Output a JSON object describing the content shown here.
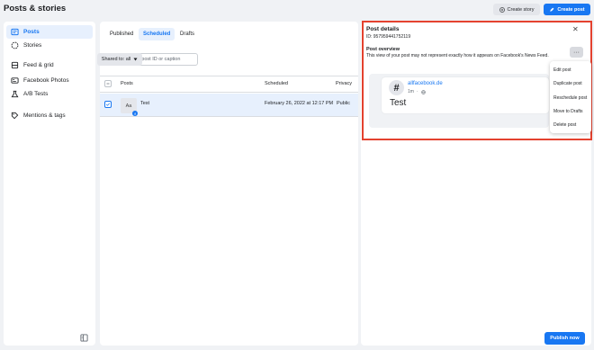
{
  "header": {
    "title": "Posts & stories",
    "create_story_label": "Create story",
    "create_post_label": "Create post"
  },
  "sidebar": {
    "items": [
      {
        "label": "Posts",
        "icon": "posts-icon",
        "active": true
      },
      {
        "label": "Stories",
        "icon": "stories-icon",
        "active": false
      },
      {
        "label": "Feed & grid",
        "icon": "feed-grid-icon",
        "active": false
      },
      {
        "label": "Facebook Photos",
        "icon": "photos-icon",
        "active": false
      },
      {
        "label": "A/B Tests",
        "icon": "ab-test-icon",
        "active": false
      },
      {
        "label": "Mentions & tags",
        "icon": "tag-icon",
        "active": false
      }
    ]
  },
  "center": {
    "tabs": [
      {
        "label": "Published",
        "active": false
      },
      {
        "label": "Scheduled",
        "active": true
      },
      {
        "label": "Drafts",
        "active": false
      }
    ],
    "search": {
      "placeholder": "Search by post ID or caption",
      "value": ""
    },
    "filter": {
      "label": "Shared to: all"
    },
    "table": {
      "columns": [
        "Posts",
        "Scheduled",
        "Privacy"
      ],
      "rows": [
        {
          "thumb": "Aa",
          "title": "Test",
          "scheduled": "February 26, 2022 at 12:17 PM",
          "privacy": "Public",
          "selected": true
        }
      ]
    }
  },
  "details": {
    "title": "Post details",
    "id_text": "ID: 957959441752119",
    "overview_title": "Post overview",
    "overview_text": "This view of your post may not represent exactly how it appears on Facebook's News Feed.",
    "preview": {
      "avatar_glyph": "#",
      "page_name": "allfacebook.de",
      "time": "1m",
      "body": "Test"
    },
    "menu": [
      "Edit post",
      "Duplicate post",
      "Reschedule post",
      "Move to Drafts",
      "Delete post"
    ],
    "publish_label": "Publish now"
  },
  "colors": {
    "accent": "#1877f2",
    "highlight_border": "#e4422f",
    "selected_row": "#e7f0fd"
  }
}
